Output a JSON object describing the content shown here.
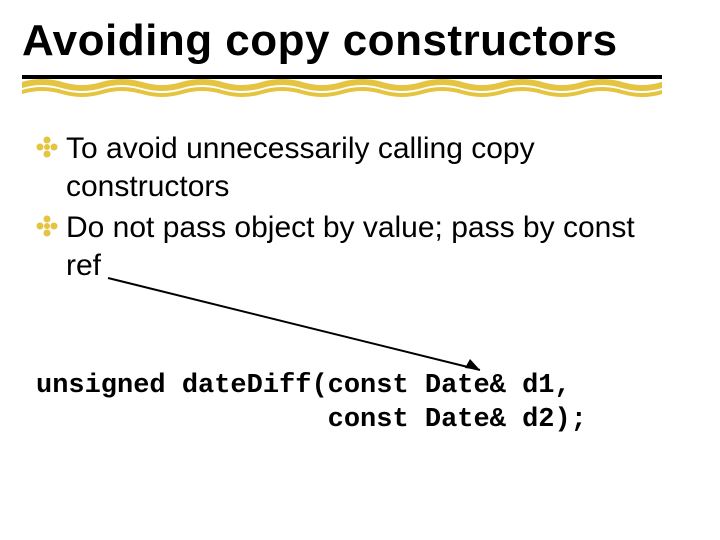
{
  "title": "Avoiding copy constructors",
  "bullets": [
    "To avoid unnecessarily calling copy constructors",
    "Do not pass object by value; pass by const ref"
  ],
  "code": "unsigned dateDiff(const Date& d1,\n                  const Date& d2);"
}
